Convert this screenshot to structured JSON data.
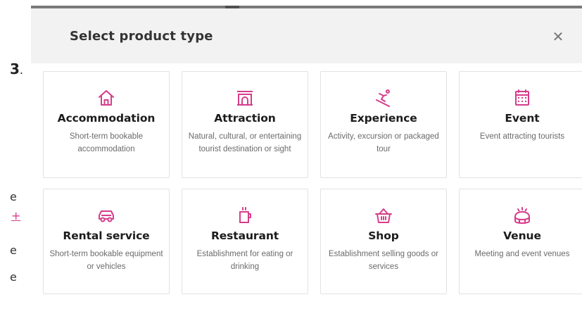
{
  "background": {
    "step_number": "3",
    "step_dot": ".",
    "frag_e1": "e",
    "frag_plus": "+",
    "frag_e2": "e",
    "frag_e3": "e"
  },
  "modal": {
    "title": "Select product type",
    "close_label": "✕",
    "accent_color": "#d63c8a"
  },
  "product_types": [
    {
      "title": "Accommodation",
      "description": "Short-term bookable accommodation",
      "icon": "house-icon"
    },
    {
      "title": "Attraction",
      "description": "Natural, cultural, or entertaining tourist destination or sight",
      "icon": "arch-icon"
    },
    {
      "title": "Experience",
      "description": "Activity, excursion or packaged tour",
      "icon": "skier-icon"
    },
    {
      "title": "Event",
      "description": "Event attracting tourists",
      "icon": "calendar-icon"
    },
    {
      "title": "Rental service",
      "description": "Short-term bookable equipment or vehicles",
      "icon": "car-icon"
    },
    {
      "title": "Restaurant",
      "description": "Establishment for eating or drinking",
      "icon": "coffee-cup-icon"
    },
    {
      "title": "Shop",
      "description": "Establishment selling goods or services",
      "icon": "basket-icon"
    },
    {
      "title": "Venue",
      "description": "Meeting and event venues",
      "icon": "stadium-icon"
    }
  ]
}
